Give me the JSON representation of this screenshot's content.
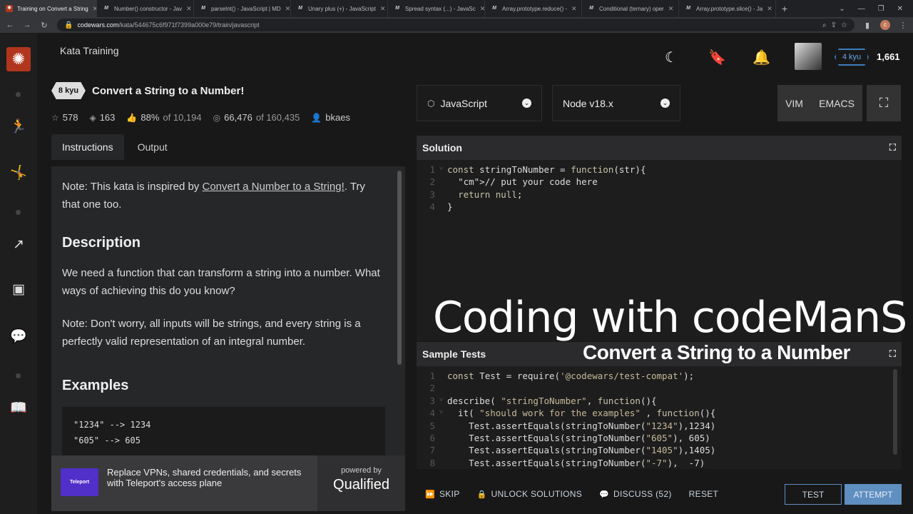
{
  "browser": {
    "tabs": [
      {
        "title": "Training on Convert a String",
        "active": true,
        "icon": "codewars"
      },
      {
        "title": "Number() constructor - Jav",
        "icon": "mdn"
      },
      {
        "title": "parseInt() - JavaScript | MD",
        "icon": "mdn"
      },
      {
        "title": "Unary plus (+) - JavaScript",
        "icon": "mdn"
      },
      {
        "title": "Spread syntax (...) - JavaSc",
        "icon": "mdn"
      },
      {
        "title": "Array.prototype.reduce() -",
        "icon": "mdn"
      },
      {
        "title": "Conditional (ternary) oper",
        "icon": "mdn"
      },
      {
        "title": "Array.prototype.slice() - Ja",
        "icon": "mdn"
      }
    ],
    "url_host": "codewars.com",
    "url_path": "/kata/544675c6f971f7399a000e79/train/javascript",
    "profile_initial": "c"
  },
  "header": {
    "title": "Kata Training",
    "rank": "4 kyu",
    "honor": "1,661"
  },
  "kata": {
    "rank": "8 kyu",
    "title": "Convert a String to a Number!",
    "stars": "578",
    "collections": "163",
    "satisfaction": "88%",
    "satisfaction_of": "of 10,194",
    "completed": "66,476",
    "completed_of": "of 160,435",
    "author": "bkaes"
  },
  "left_tabs": {
    "instructions": "Instructions",
    "output": "Output"
  },
  "description": {
    "note_prefix": "Note: This kata is inspired by ",
    "note_link": "Convert a Number to a String!",
    "note_suffix": ". Try that one too.",
    "heading_desc": "Description",
    "para1": "We need a function that can transform a string into a number. What ways of achieving this do you know?",
    "para2": "Note: Don't worry, all inputs will be strings, and every string is a perfectly valid representation of an integral number.",
    "heading_examples": "Examples",
    "example_line1": "\"1234\" --> 1234",
    "example_line2": "\"605\" --> 605"
  },
  "promo": {
    "logo_text": "Teleport",
    "text": "Replace VPNs, shared credentials, and secrets with Teleport's access plane",
    "powered_by": "powered by",
    "brand": "Qualified"
  },
  "editor_controls": {
    "language": "JavaScript",
    "runtime": "Node v18.x",
    "vim": "VIM",
    "emacs": "EMACS"
  },
  "solution": {
    "label": "Solution",
    "lines": [
      {
        "n": "1",
        "fold": "˅",
        "code": "const stringToNumber = function(str){"
      },
      {
        "n": "2",
        "fold": "",
        "code": "  // put your code here"
      },
      {
        "n": "3",
        "fold": "",
        "code": "  return null;"
      },
      {
        "n": "4",
        "fold": "",
        "code": "}"
      }
    ]
  },
  "sample_tests": {
    "label": "Sample Tests",
    "lines": [
      {
        "n": "1",
        "fold": "",
        "code": "const Test = require('@codewars/test-compat');"
      },
      {
        "n": "2",
        "fold": "",
        "code": ""
      },
      {
        "n": "3",
        "fold": "˅",
        "code": "describe( \"stringToNumber\", function(){"
      },
      {
        "n": "4",
        "fold": "˅",
        "code": "  it( \"should work for the examples\" , function(){"
      },
      {
        "n": "5",
        "fold": "",
        "code": "    Test.assertEquals(stringToNumber(\"1234\"),1234)"
      },
      {
        "n": "6",
        "fold": "",
        "code": "    Test.assertEquals(stringToNumber(\"605\"), 605)"
      },
      {
        "n": "7",
        "fold": "",
        "code": "    Test.assertEquals(stringToNumber(\"1405\"),1405)"
      },
      {
        "n": "8",
        "fold": "",
        "code": "    Test.assertEquals(stringToNumber(\"-7\"),  -7)"
      }
    ]
  },
  "overlay": {
    "title": "Coding with codeManS",
    "subtitle": "Convert a String to a Number"
  },
  "actions": {
    "skip": "SKIP",
    "unlock": "UNLOCK SOLUTIONS",
    "discuss": "DISCUSS (52)",
    "reset": "RESET",
    "test": "TEST",
    "attempt": "ATTEMPT"
  },
  "colors": {
    "brand": "#b1361e",
    "accent": "#5f8ec0",
    "panel": "#262729"
  }
}
